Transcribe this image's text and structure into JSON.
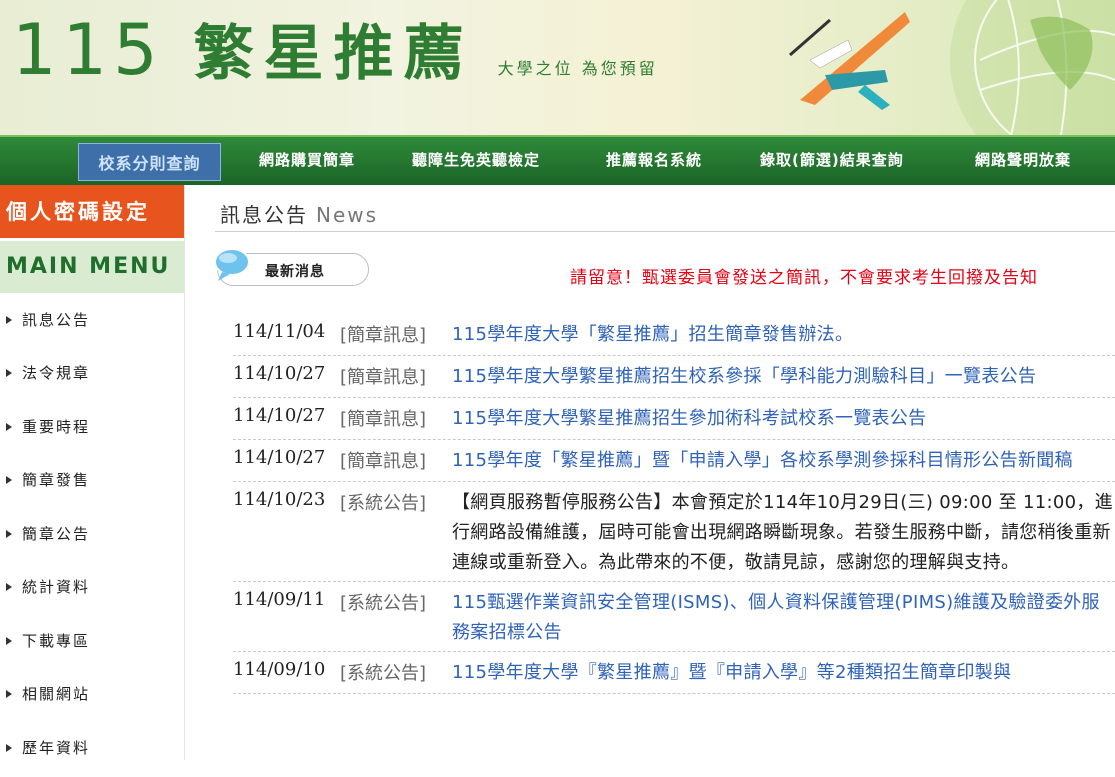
{
  "banner": {
    "year": "115",
    "title": "繁星推薦",
    "slogan": "大學之位 為您預留"
  },
  "nav": {
    "first": "校系分則查詢",
    "items": [
      "網路購買簡章",
      "聽障生免英聽檢定",
      "推薦報名系統",
      "錄取(篩選)結果查詢",
      "網路聲明放棄"
    ]
  },
  "sidebar": {
    "password_button": "個人密碼設定",
    "menu_title": "MAIN MENU",
    "items": [
      "訊息公告",
      "法令規章",
      "重要時程",
      "簡章發售",
      "簡章公告",
      "統計資料",
      "下載專區",
      "相關網站",
      "歷年資料"
    ]
  },
  "main": {
    "heading": "訊息公告",
    "heading_en": "News",
    "latest_label": "最新消息",
    "warning": "請留意！甄選委員會發送之簡訊，不會要求考生回撥及告知",
    "news": [
      {
        "date": "114/11/04",
        "category": "[簡章訊息]",
        "title": "115學年度大學「繁星推薦」招生簡章發售辦法。",
        "style": "link"
      },
      {
        "date": "114/10/27",
        "category": "[簡章訊息]",
        "title": "115學年度大學繁星推薦招生校系參採「學科能力測驗科目」一覽表公告",
        "style": "link"
      },
      {
        "date": "114/10/27",
        "category": "[簡章訊息]",
        "title": "115學年度大學繁星推薦招生參加術科考試校系一覽表公告",
        "style": "link"
      },
      {
        "date": "114/10/27",
        "category": "[簡章訊息]",
        "title": "115學年度「繁星推薦」暨「申請入學」各校系學測參採科目情形公告新聞稿",
        "style": "link"
      },
      {
        "date": "114/10/23",
        "category": "[系統公告]",
        "title": "【網頁服務暫停服務公告】本會預定於114年10月29日(三) 09:00 至 11:00，進行網路設備維護，屆時可能會出現網路瞬斷現象。若發生服務中斷，請您稍後重新連線或重新登入。為此帶來的不便，敬請見諒，感謝您的理解與支持。",
        "style": "plain"
      },
      {
        "date": "114/09/11",
        "category": "[系統公告]",
        "title": "115甄選作業資訊安全管理(ISMS)、個人資料保護管理(PIMS)維護及驗證委外服務案招標公告",
        "style": "link"
      },
      {
        "date": "114/09/10",
        "category": "[系統公告]",
        "title": "115學年度大學『繁星推薦』暨『申請入學』等2種類招生簡章印製與",
        "style": "link"
      }
    ]
  },
  "colors": {
    "brand_green": "#2f7d32",
    "nav_green": "#1b6427",
    "accent_orange": "#e8541e",
    "link_blue": "#2f63b8",
    "warning_red": "#e60012"
  }
}
